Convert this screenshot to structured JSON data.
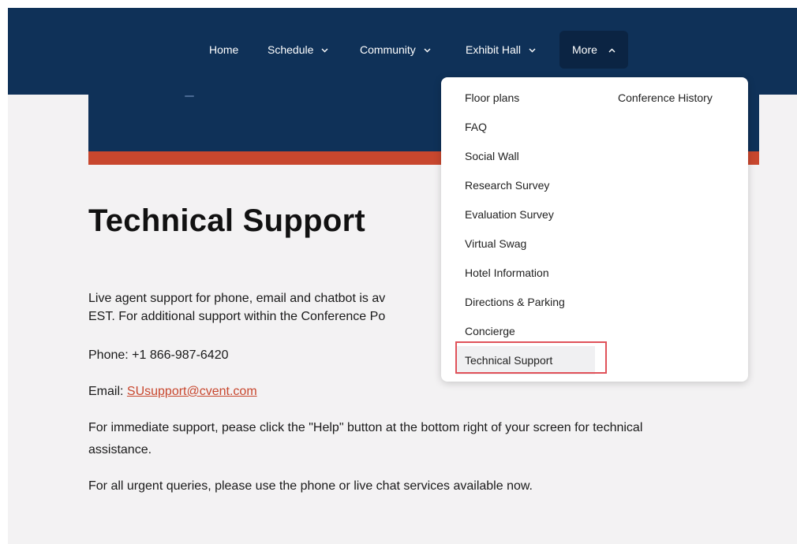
{
  "nav": {
    "items": [
      {
        "label": "Home",
        "has_chevron": false
      },
      {
        "label": "Schedule",
        "has_chevron": true
      },
      {
        "label": "Community",
        "has_chevron": true
      },
      {
        "label": "Exhibit Hall",
        "has_chevron": true
      },
      {
        "label": "More",
        "has_chevron": true,
        "expanded": true
      }
    ]
  },
  "dropdown": {
    "left_column": [
      "Floor plans",
      "FAQ",
      "Social Wall",
      "Research Survey",
      "Evaluation Survey",
      "Virtual Swag",
      "Hotel Information",
      "Directions & Parking",
      "Concierge",
      "Technical Support"
    ],
    "right_column": [
      "Conference History"
    ],
    "highlighted_item": "Technical Support"
  },
  "page": {
    "title": "Technical Support",
    "intro_line1": "Live agent support for phone, email and chatbot is av",
    "intro_line2": "EST.  For additional support within the Conference Po",
    "phone": "Phone: +1 866-987-6420",
    "email_label": "Email: ",
    "email": "SUsupport@cvent.com",
    "immediate_line1": "For immediate support, pease click the \"Help\" button at the bottom right of your screen for technical",
    "immediate_line2": "assistance.",
    "urgent": "For all urgent queries, please use the phone or live chat services available now."
  },
  "colors": {
    "nav_bg": "#0f3158",
    "accent_stripe": "#c8472e",
    "link": "#c8472e",
    "highlight_border": "#e0525a"
  }
}
